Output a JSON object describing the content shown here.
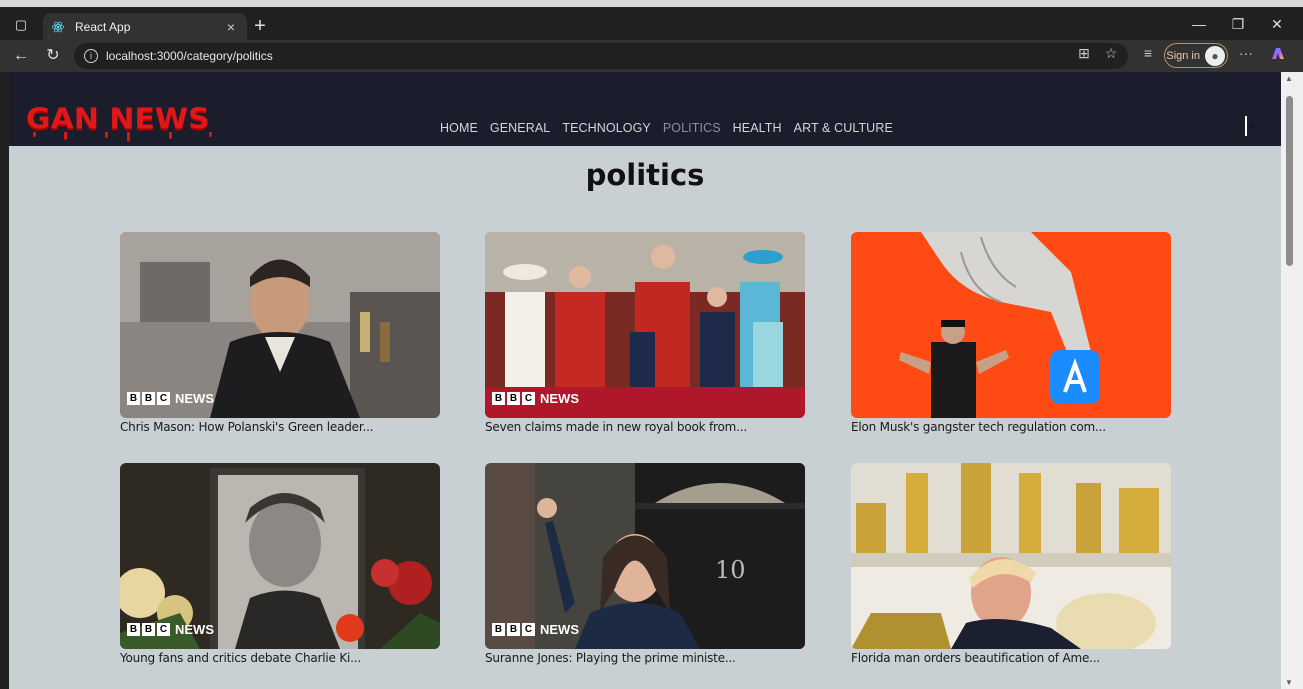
{
  "browser": {
    "tab_title": "React App",
    "tab_close": "×",
    "new_tab": "+",
    "url": "localhost:3000/category/politics",
    "sign_in": "Sign in",
    "more": "···"
  },
  "site": {
    "logo": "GAN NEWS",
    "nav": [
      "HOME",
      "GENERAL",
      "TECHNOLOGY",
      "POLITICS",
      "HEALTH",
      "ART & CULTURE"
    ],
    "active_nav": "POLITICS"
  },
  "page": {
    "title": "politics",
    "bbc_label": "NEWS",
    "cards": [
      {
        "caption": "Chris Mason: How Polanski's Green leader...",
        "bbc": true
      },
      {
        "caption": "Seven claims made in new royal book from...",
        "bbc": true
      },
      {
        "caption": "Elon Musk's gangster tech regulation com...",
        "bbc": false
      },
      {
        "caption": "Young fans and critics debate Charlie Ki...",
        "bbc": true
      },
      {
        "caption": "Suranne Jones: Playing the prime ministe...",
        "bbc": true
      },
      {
        "caption": "Florida man orders beautification of Ame...",
        "bbc": false
      }
    ]
  },
  "colors": {
    "header_bg": "#1b1c2c",
    "page_bg": "#c8d0d4",
    "logo_red": "#e01818"
  }
}
